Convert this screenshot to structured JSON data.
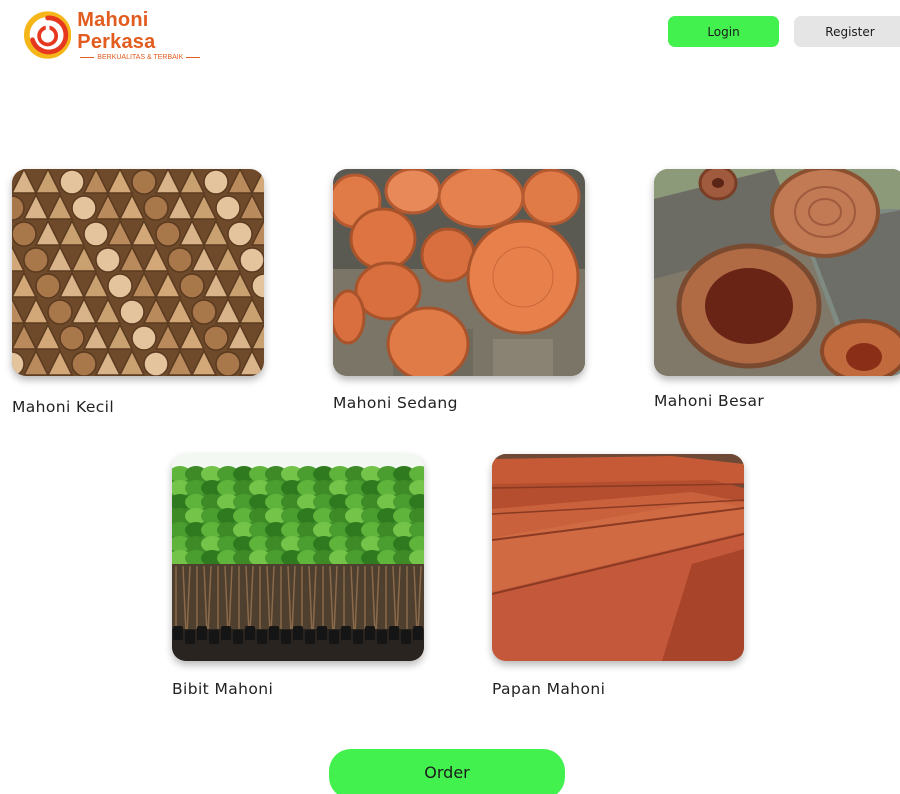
{
  "header": {
    "brand_name": "Mahoni Perkasa",
    "brand_tagline": "BERKUALITAS & TERBAIK",
    "login_label": "Login",
    "register_label": "Register"
  },
  "products": [
    {
      "id": "kecil",
      "label": "Mahoni Kecil",
      "image": "split-firewood-stack"
    },
    {
      "id": "sedang",
      "label": "Mahoni Sedang",
      "image": "log-ends-pile"
    },
    {
      "id": "besar",
      "label": "Mahoni Besar",
      "image": "large-log-cross-sections"
    },
    {
      "id": "bibit",
      "label": "Bibit Mahoni",
      "image": "mahogany-seedlings"
    },
    {
      "id": "papan",
      "label": "Papan Mahoni",
      "image": "mahogany-planks"
    }
  ],
  "order_label": "Order",
  "colors": {
    "accent_green": "#42f04e",
    "brand_orange": "#e25c1f",
    "brand_yellow": "#f5b61a",
    "register_gray": "#e5e5e5"
  }
}
